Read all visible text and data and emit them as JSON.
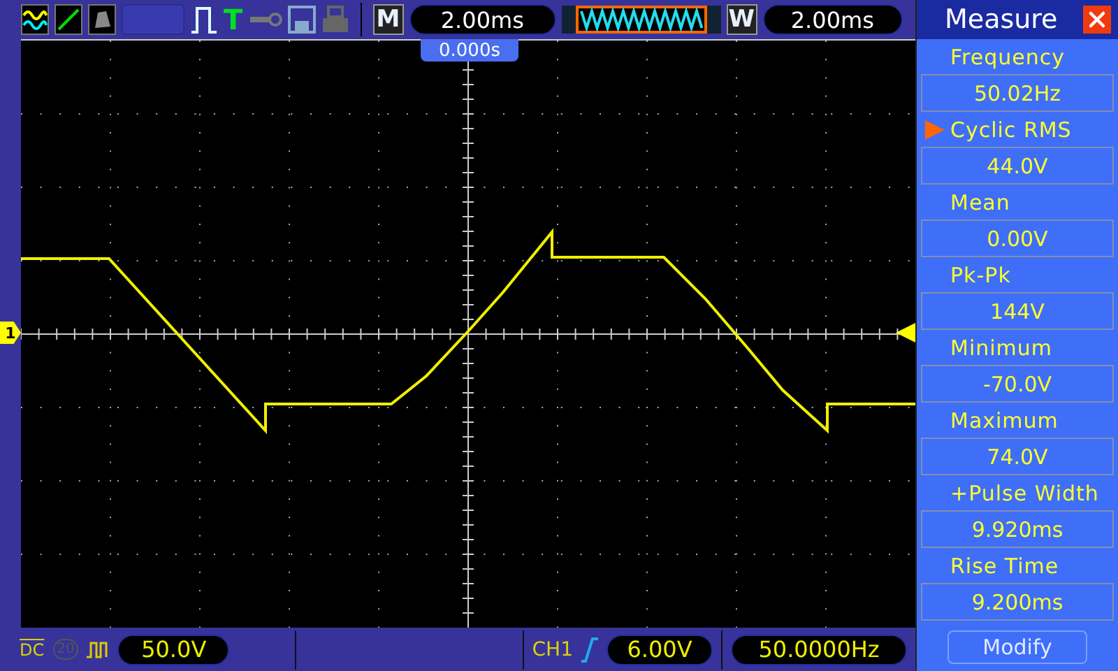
{
  "toolbar": {
    "trigger_status": "T",
    "main_key": "M",
    "timebase": "2.00ms",
    "window_key": "W",
    "window_timebase": "2.00ms"
  },
  "screen": {
    "trigger_time": "0.000s",
    "channel_marker": "1"
  },
  "measure_panel": {
    "title": "Measure",
    "measurements": [
      {
        "name": "Frequency",
        "value": "50.02Hz",
        "selected": false
      },
      {
        "name": "Cyclic RMS",
        "value": "44.0V",
        "selected": true
      },
      {
        "name": "Mean",
        "value": "0.00V",
        "selected": false
      },
      {
        "name": "Pk-Pk",
        "value": "144V",
        "selected": false
      },
      {
        "name": "Minimum",
        "value": "-70.0V",
        "selected": false
      },
      {
        "name": "Maximum",
        "value": "74.0V",
        "selected": false
      },
      {
        "name": "+Pulse Width",
        "value": "9.920ms",
        "selected": false
      },
      {
        "name": "Rise Time",
        "value": "9.200ms",
        "selected": false
      }
    ],
    "modify_button": "Modify"
  },
  "bottom_bar": {
    "coupling": "DC",
    "bandwidth_limit": "20",
    "volts_per_div": "50.0V",
    "trigger_source": "CH1",
    "trigger_level": "6.00V",
    "frequency": "50.0000Hz"
  }
}
